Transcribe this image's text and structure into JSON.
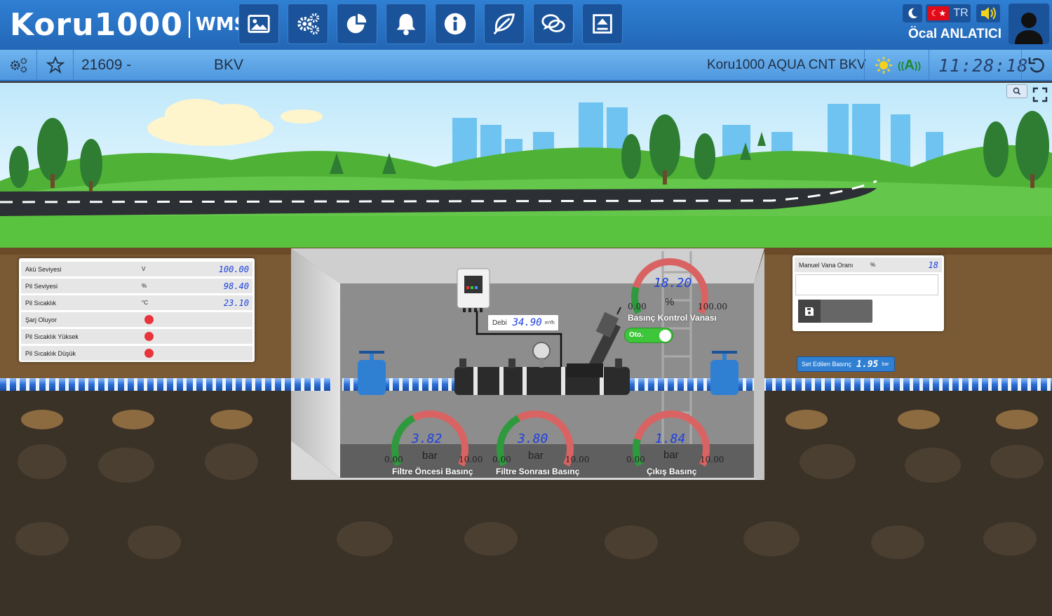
{
  "header": {
    "brand": "Koru1000",
    "product": "WMS",
    "toolbar_icons": [
      "image-icon",
      "gears-icon",
      "pie-chart-icon",
      "bell-icon",
      "info-icon",
      "leaf-icon",
      "chat-icon",
      "export-icon"
    ],
    "language": "TR",
    "user_name": "Öcal ANLATICI"
  },
  "subbar": {
    "station_id": "21609 -",
    "station_name": "BKV",
    "device_name": "Koru1000 AQUA CNT BKV",
    "signal_label": "A",
    "clock": "11:28:18"
  },
  "left_panel": {
    "rows": [
      {
        "label": "Akü Seviyesi",
        "unit": "V",
        "value": "100.00"
      },
      {
        "label": "Pil Seviyesi",
        "unit": "%",
        "value": "98.40"
      },
      {
        "label": "Pil Sıcaklık",
        "unit": "°C",
        "value": "23.10"
      },
      {
        "label": "Şarj Oluyor",
        "status": "red"
      },
      {
        "label": "Pil Sıcaklık Yüksek",
        "status": "red"
      },
      {
        "label": "Pil Sıcaklık Düşük",
        "status": "red"
      }
    ]
  },
  "right_panel": {
    "label": "Manuel Vana Oranı",
    "unit": "%",
    "value": "18",
    "input_value": "",
    "save_icon": "floppy-disk-icon"
  },
  "setpoint": {
    "label": "Set Edilen Basınç",
    "value": "1.95",
    "unit": "bar"
  },
  "flow": {
    "label": "Debi",
    "value": "34.90",
    "unit": "m³/h"
  },
  "device_box_label": "Koru1000 AQUA CNT",
  "mode_toggle": {
    "label": "Oto.",
    "on": true
  },
  "gauges": {
    "valve": {
      "title": "Basınç Kontrol Vanası",
      "value": "18.20",
      "unit": "%",
      "min": "0.00",
      "max": "100.00",
      "level": 0.182
    },
    "filter_in": {
      "title": "Filtre Öncesi Basınç",
      "value": "3.82",
      "unit": "bar",
      "min": "0.00",
      "max": "10.00",
      "level": 0.382
    },
    "filter_out": {
      "title": "Filtre Sonrası Basınç",
      "value": "3.80",
      "unit": "bar",
      "min": "0.00",
      "max": "10.00",
      "level": 0.38
    },
    "outlet": {
      "title": "Çıkış Basınç",
      "value": "1.84",
      "unit": "bar",
      "min": "0.00",
      "max": "10.00",
      "level": 0.184
    }
  },
  "colors": {
    "topbar": "#2367b6",
    "subbar": "#5ea6e8",
    "sky": "#c9ecfb",
    "grass": "#5cc641",
    "soil": "#7a5a35",
    "gauge_green": "#2f9a3d",
    "gauge_red": "#d96363",
    "value_blue": "#1a3fe0"
  }
}
